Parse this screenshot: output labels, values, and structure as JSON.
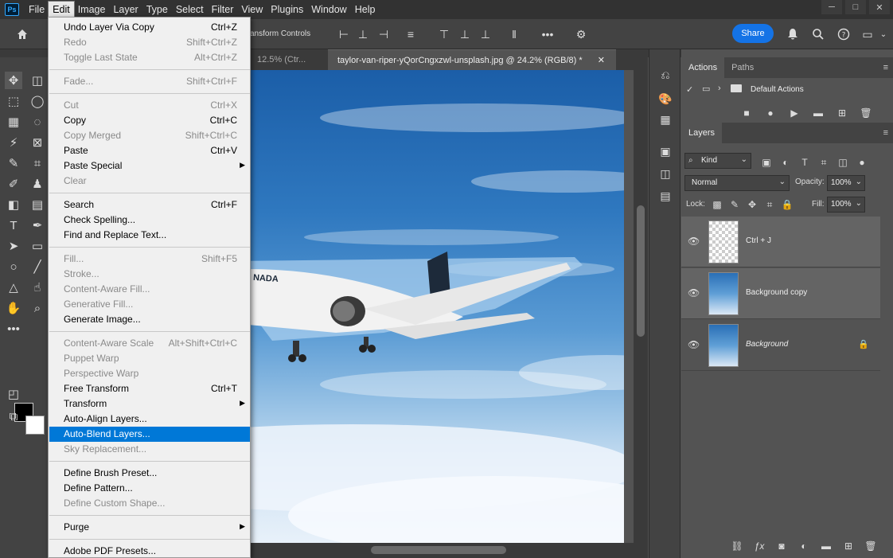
{
  "app": {
    "logo": "Ps"
  },
  "menubar": [
    "File",
    "Edit",
    "Image",
    "Layer",
    "Type",
    "Select",
    "Filter",
    "View",
    "Plugins",
    "Window",
    "Help"
  ],
  "window_controls": [
    "─",
    "□",
    "✕"
  ],
  "options_bar": {
    "transform_controls": "ansform Controls",
    "share_label": "Share"
  },
  "tabs": [
    {
      "label": "12.5% (Ctr...",
      "close": "✕"
    },
    {
      "label": "taylor-van-riper-yQorCngxzwl-unsplash.jpg @ 24.2% (RGB/8) *",
      "close": "✕"
    }
  ],
  "edit_menu": [
    {
      "label": "Undo Layer Via Copy",
      "shortcut": "Ctrl+Z",
      "disabled": false
    },
    {
      "label": "Redo",
      "shortcut": "Shift+Ctrl+Z",
      "disabled": true
    },
    {
      "label": "Toggle Last State",
      "shortcut": "Alt+Ctrl+Z",
      "disabled": true
    },
    {
      "sep": true
    },
    {
      "label": "Fade...",
      "shortcut": "Shift+Ctrl+F",
      "disabled": true
    },
    {
      "sep": true
    },
    {
      "label": "Cut",
      "shortcut": "Ctrl+X",
      "disabled": true
    },
    {
      "label": "Copy",
      "shortcut": "Ctrl+C",
      "disabled": false
    },
    {
      "label": "Copy Merged",
      "shortcut": "Shift+Ctrl+C",
      "disabled": true
    },
    {
      "label": "Paste",
      "shortcut": "Ctrl+V",
      "disabled": false
    },
    {
      "label": "Paste Special",
      "shortcut": "",
      "disabled": false,
      "submenu": true
    },
    {
      "label": "Clear",
      "shortcut": "",
      "disabled": true
    },
    {
      "sep": true
    },
    {
      "label": "Search",
      "shortcut": "Ctrl+F",
      "disabled": false
    },
    {
      "label": "Check Spelling...",
      "shortcut": "",
      "disabled": false
    },
    {
      "label": "Find and Replace Text...",
      "shortcut": "",
      "disabled": false
    },
    {
      "sep": true
    },
    {
      "label": "Fill...",
      "shortcut": "Shift+F5",
      "disabled": true
    },
    {
      "label": "Stroke...",
      "shortcut": "",
      "disabled": true
    },
    {
      "label": "Content-Aware Fill...",
      "shortcut": "",
      "disabled": true
    },
    {
      "label": "Generative Fill...",
      "shortcut": "",
      "disabled": true
    },
    {
      "label": "Generate Image...",
      "shortcut": "",
      "disabled": false
    },
    {
      "sep": true
    },
    {
      "label": "Content-Aware Scale",
      "shortcut": "Alt+Shift+Ctrl+C",
      "disabled": true
    },
    {
      "label": "Puppet Warp",
      "shortcut": "",
      "disabled": true
    },
    {
      "label": "Perspective Warp",
      "shortcut": "",
      "disabled": true
    },
    {
      "label": "Free Transform",
      "shortcut": "Ctrl+T",
      "disabled": false
    },
    {
      "label": "Transform",
      "shortcut": "",
      "disabled": false,
      "submenu": true
    },
    {
      "label": "Auto-Align Layers...",
      "shortcut": "",
      "disabled": false
    },
    {
      "label": "Auto-Blend Layers...",
      "shortcut": "",
      "disabled": false,
      "highlighted": true
    },
    {
      "label": "Sky Replacement...",
      "shortcut": "",
      "disabled": true
    },
    {
      "sep": true
    },
    {
      "label": "Define Brush Preset...",
      "shortcut": "",
      "disabled": false
    },
    {
      "label": "Define Pattern...",
      "shortcut": "",
      "disabled": false
    },
    {
      "label": "Define Custom Shape...",
      "shortcut": "",
      "disabled": true
    },
    {
      "sep": true
    },
    {
      "label": "Purge",
      "shortcut": "",
      "disabled": false,
      "submenu": true
    },
    {
      "sep": true
    },
    {
      "label": "Adobe PDF Presets...",
      "shortcut": "",
      "disabled": false
    }
  ],
  "actions_panel": {
    "tabs": [
      "Actions",
      "Paths"
    ],
    "set_name": "Default Actions"
  },
  "layers_panel": {
    "tab": "Layers",
    "filter": "Kind",
    "blend_mode": "Normal",
    "opacity_label": "Opacity:",
    "opacity": "100%",
    "lock_label": "Lock:",
    "fill_label": "Fill:",
    "fill": "100%",
    "layers": [
      {
        "name": "Ctrl + J",
        "thumb": "transparent"
      },
      {
        "name": "Background copy",
        "thumb": "sky"
      },
      {
        "name": "Background",
        "thumb": "sky",
        "locked": true
      }
    ]
  },
  "canvas_text": "NADA",
  "colors": {
    "accent": "#1473e6",
    "menu_highlight": "#0078d7",
    "checkmark": "#e01b1b"
  }
}
